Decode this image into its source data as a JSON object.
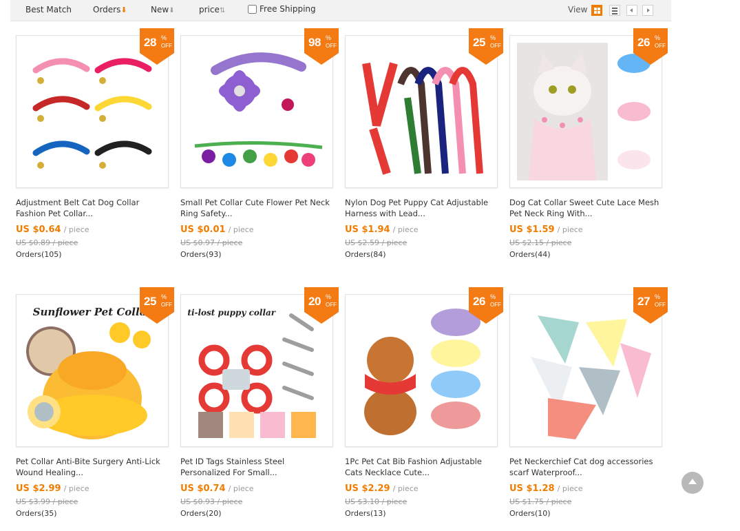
{
  "sort": {
    "best_match": "Best Match",
    "orders": "Orders",
    "orders_arrow": "⬇",
    "new": "New",
    "new_arrow": "⬇",
    "price": "price",
    "price_arrow": "⇅",
    "free_shipping": "Free Shipping",
    "view_label": "View"
  },
  "colors": {
    "accent": "#f07c00",
    "badge": "#f47b14"
  },
  "products": [
    {
      "discount": "28",
      "pct": "%",
      "off": "OFF",
      "title": "Adjustment Belt Cat Dog Collar Fashion Pet Collar...",
      "price": "US $0.64",
      "unit": "/ piece",
      "old_price": "US $0.89 / piece",
      "orders": "Orders(105)",
      "image_icon": "colorful-cat-collars-image"
    },
    {
      "discount": "98",
      "pct": "%",
      "off": "OFF",
      "title": "Small Pet Collar Cute Flower Pet Neck Ring Safety...",
      "price": "US $0.01",
      "unit": "/ piece",
      "old_price": "US $0.97 / piece",
      "orders": "Orders(93)",
      "image_icon": "flower-collar-image"
    },
    {
      "discount": "25",
      "pct": "%",
      "off": "OFF",
      "title": "Nylon Dog Pet Puppy Cat Adjustable Harness with Lead...",
      "price": "US $1.94",
      "unit": "/ piece",
      "old_price": "US $2.59 / piece",
      "orders": "Orders(84)",
      "image_icon": "harness-leashes-image"
    },
    {
      "discount": "26",
      "pct": "%",
      "off": "OFF",
      "title": "Dog Cat Collar Sweet Cute Lace Mesh Pet Neck Ring With...",
      "price": "US $1.59",
      "unit": "/ piece",
      "old_price": "US $2.15 / piece",
      "orders": "Orders(44)",
      "image_icon": "cat-lace-collar-image"
    },
    {
      "discount": "25",
      "pct": "%",
      "off": "OFF",
      "title": "Pet Collar Anti-Bite Surgery Anti-Lick Wound Healing...",
      "price": "US $2.99",
      "unit": "/ piece",
      "old_price": "US $3.99 / piece",
      "orders": "Orders(35)",
      "image_icon": "sunflower-collar-image",
      "image_text": "Sunflower Pet Collar"
    },
    {
      "discount": "20",
      "pct": "%",
      "off": "OFF",
      "title": "Pet ID Tags Stainless Steel Personalized For Small...",
      "price": "US $0.74",
      "unit": "/ piece",
      "old_price": "US $0.93 / piece",
      "orders": "Orders(20)",
      "image_icon": "id-tags-image",
      "image_text": "anti-lost puppy collar"
    },
    {
      "discount": "26",
      "pct": "%",
      "off": "OFF",
      "title": "1Pc Pet Cat Bib Fashion Adjustable Cats Necklace Cute...",
      "price": "US $2.29",
      "unit": "/ piece",
      "old_price": "US $3.10 / piece",
      "orders": "Orders(13)",
      "image_icon": "cat-bib-image"
    },
    {
      "discount": "27",
      "pct": "%",
      "off": "OFF",
      "title": "Pet Neckerchief Cat dog accessories scarf Waterproof...",
      "price": "US $1.28",
      "unit": "/ piece",
      "old_price": "US $1.75 / piece",
      "orders": "Orders(10)",
      "image_icon": "neckerchief-image"
    }
  ]
}
